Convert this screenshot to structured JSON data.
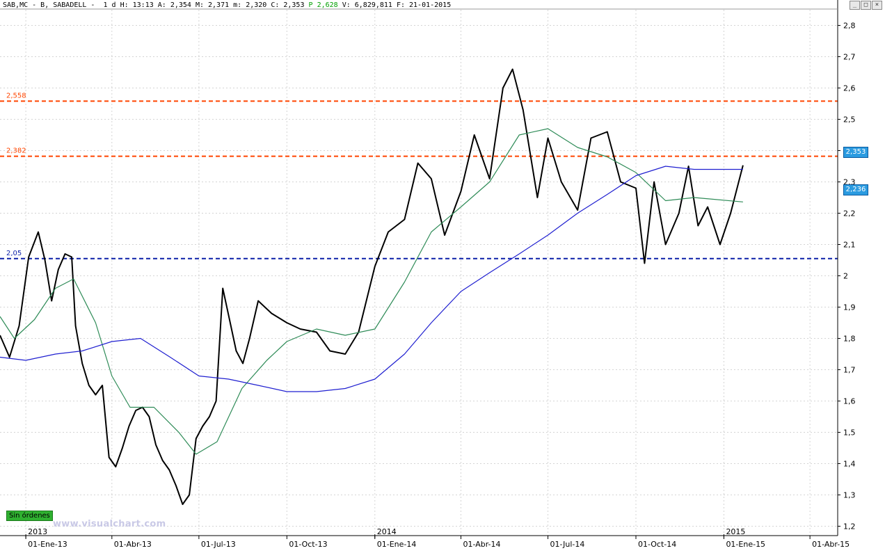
{
  "header": {
    "text": "SAB,MC - B, SABADELL -  1 d H: 13:13 A: 2,354 M: 2,371 m: 2,320 C: 2,353 ",
    "p_label": "P",
    "p_value": "2,628",
    "tail": " V: 6,829,811 F: 21-01-2015"
  },
  "window_buttons": [
    "_",
    "□",
    "×"
  ],
  "status_label": "Sin órdenes",
  "watermark": "www.visualchart.com",
  "price_badges": {
    "last": "2,353",
    "ma": "2,236"
  },
  "colors": {
    "candles": "#000000",
    "ma_short": "#2e8b57",
    "ma_long": "#1f1fd0",
    "resistance": "#ff4500",
    "support": "#0a1fa8",
    "badge": "#2b9be0",
    "grid": "#d4d4d4"
  },
  "chart_data": {
    "type": "line",
    "title": "SAB,MC - B, SABADELL",
    "x_axis": {
      "tick_labels": [
        "01-Ene-13",
        "01-Abr-13",
        "01-Jul-13",
        "01-Oct-13",
        "01-Ene-14",
        "01-Abr-14",
        "01-Jul-14",
        "01-Oct-14",
        "01-Ene-15",
        "01-Abr-15"
      ],
      "year_labels": [
        "2013",
        "2014",
        "2015"
      ],
      "range": [
        "2012-12-05",
        "2015-04-30"
      ]
    },
    "y_axis": {
      "tick_labels": [
        "1,2",
        "1,3",
        "1,4",
        "1,5",
        "1,6",
        "1,7",
        "1,8",
        "1,9",
        "2",
        "2,1",
        "2,2",
        "2,3",
        "2,4",
        "2,5",
        "2,6",
        "2,7",
        "2,8"
      ],
      "range": [
        1.17,
        2.85
      ],
      "grid": true
    },
    "horizontal_lines": [
      {
        "label": "2,558",
        "value": 2.558,
        "color": "#ff4500"
      },
      {
        "label": "2,382",
        "value": 2.382,
        "color": "#ff4500"
      },
      {
        "label": "2,05",
        "value": 2.055,
        "color": "#0a1fa8"
      }
    ],
    "series": [
      {
        "kind": "price",
        "color": "#000000",
        "points": [
          [
            "2012-12-05",
            1.81
          ],
          [
            "2012-12-15",
            1.74
          ],
          [
            "2012-12-25",
            1.84
          ],
          [
            "2013-01-04",
            2.06
          ],
          [
            "2013-01-14",
            2.14
          ],
          [
            "2013-01-21",
            2.05
          ],
          [
            "2013-01-28",
            1.92
          ],
          [
            "2013-02-04",
            2.02
          ],
          [
            "2013-02-11",
            2.07
          ],
          [
            "2013-02-18",
            2.06
          ],
          [
            "2013-02-22",
            1.84
          ],
          [
            "2013-03-01",
            1.72
          ],
          [
            "2013-03-08",
            1.65
          ],
          [
            "2013-03-15",
            1.62
          ],
          [
            "2013-03-22",
            1.65
          ],
          [
            "2013-03-29",
            1.42
          ],
          [
            "2013-04-05",
            1.39
          ],
          [
            "2013-04-12",
            1.45
          ],
          [
            "2013-04-19",
            1.52
          ],
          [
            "2013-04-26",
            1.57
          ],
          [
            "2013-05-03",
            1.58
          ],
          [
            "2013-05-10",
            1.55
          ],
          [
            "2013-05-17",
            1.46
          ],
          [
            "2013-05-24",
            1.41
          ],
          [
            "2013-05-31",
            1.38
          ],
          [
            "2013-06-07",
            1.33
          ],
          [
            "2013-06-14",
            1.27
          ],
          [
            "2013-06-21",
            1.3
          ],
          [
            "2013-06-28",
            1.48
          ],
          [
            "2013-07-05",
            1.52
          ],
          [
            "2013-07-12",
            1.55
          ],
          [
            "2013-07-19",
            1.6
          ],
          [
            "2013-07-26",
            1.96
          ],
          [
            "2013-08-02",
            1.86
          ],
          [
            "2013-08-09",
            1.76
          ],
          [
            "2013-08-16",
            1.72
          ],
          [
            "2013-08-23",
            1.8
          ],
          [
            "2013-09-01",
            1.92
          ],
          [
            "2013-09-15",
            1.88
          ],
          [
            "2013-10-01",
            1.85
          ],
          [
            "2013-10-15",
            1.83
          ],
          [
            "2013-11-01",
            1.82
          ],
          [
            "2013-11-15",
            1.76
          ],
          [
            "2013-12-01",
            1.75
          ],
          [
            "2013-12-15",
            1.82
          ],
          [
            "2014-01-01",
            2.03
          ],
          [
            "2014-01-15",
            2.14
          ],
          [
            "2014-02-01",
            2.18
          ],
          [
            "2014-02-15",
            2.36
          ],
          [
            "2014-03-01",
            2.31
          ],
          [
            "2014-03-15",
            2.13
          ],
          [
            "2014-04-01",
            2.27
          ],
          [
            "2014-04-15",
            2.45
          ],
          [
            "2014-05-01",
            2.31
          ],
          [
            "2014-05-15",
            2.6
          ],
          [
            "2014-05-25",
            2.66
          ],
          [
            "2014-06-05",
            2.53
          ],
          [
            "2014-06-20",
            2.25
          ],
          [
            "2014-07-01",
            2.44
          ],
          [
            "2014-07-15",
            2.3
          ],
          [
            "2014-08-01",
            2.21
          ],
          [
            "2014-08-15",
            2.44
          ],
          [
            "2014-09-01",
            2.46
          ],
          [
            "2014-09-15",
            2.3
          ],
          [
            "2014-10-01",
            2.28
          ],
          [
            "2014-10-10",
            2.04
          ],
          [
            "2014-10-20",
            2.3
          ],
          [
            "2014-11-01",
            2.1
          ],
          [
            "2014-11-15",
            2.2
          ],
          [
            "2014-11-25",
            2.35
          ],
          [
            "2014-12-05",
            2.16
          ],
          [
            "2014-12-15",
            2.22
          ],
          [
            "2014-12-28",
            2.1
          ],
          [
            "2015-01-08",
            2.2
          ],
          [
            "2015-01-21",
            2.353
          ]
        ]
      },
      {
        "kind": "moving_average",
        "color": "#2e8b57",
        "points": [
          [
            "2012-12-05",
            1.87
          ],
          [
            "2012-12-20",
            1.8
          ],
          [
            "2013-01-10",
            1.86
          ],
          [
            "2013-02-01",
            1.96
          ],
          [
            "2013-02-20",
            1.99
          ],
          [
            "2013-03-15",
            1.85
          ],
          [
            "2013-04-01",
            1.68
          ],
          [
            "2013-04-20",
            1.58
          ],
          [
            "2013-05-15",
            1.58
          ],
          [
            "2013-06-10",
            1.5
          ],
          [
            "2013-06-28",
            1.43
          ],
          [
            "2013-07-20",
            1.47
          ],
          [
            "2013-08-15",
            1.64
          ],
          [
            "2013-09-10",
            1.73
          ],
          [
            "2013-10-01",
            1.79
          ],
          [
            "2013-11-01",
            1.83
          ],
          [
            "2013-12-01",
            1.81
          ],
          [
            "2014-01-01",
            1.83
          ],
          [
            "2014-02-01",
            1.98
          ],
          [
            "2014-03-01",
            2.14
          ],
          [
            "2014-04-01",
            2.22
          ],
          [
            "2014-05-01",
            2.3
          ],
          [
            "2014-06-01",
            2.45
          ],
          [
            "2014-07-01",
            2.47
          ],
          [
            "2014-08-01",
            2.41
          ],
          [
            "2014-09-01",
            2.38
          ],
          [
            "2014-10-01",
            2.33
          ],
          [
            "2014-11-01",
            2.24
          ],
          [
            "2014-12-01",
            2.25
          ],
          [
            "2015-01-21",
            2.236
          ]
        ]
      },
      {
        "kind": "moving_average",
        "color": "#1f1fd0",
        "points": [
          [
            "2012-12-05",
            1.74
          ],
          [
            "2013-01-01",
            1.73
          ],
          [
            "2013-02-01",
            1.75
          ],
          [
            "2013-03-01",
            1.76
          ],
          [
            "2013-04-01",
            1.79
          ],
          [
            "2013-05-01",
            1.8
          ],
          [
            "2013-06-01",
            1.74
          ],
          [
            "2013-07-01",
            1.68
          ],
          [
            "2013-08-01",
            1.67
          ],
          [
            "2013-09-01",
            1.65
          ],
          [
            "2013-10-01",
            1.63
          ],
          [
            "2013-11-01",
            1.63
          ],
          [
            "2013-12-01",
            1.64
          ],
          [
            "2014-01-01",
            1.67
          ],
          [
            "2014-02-01",
            1.75
          ],
          [
            "2014-03-01",
            1.85
          ],
          [
            "2014-04-01",
            1.95
          ],
          [
            "2014-05-01",
            2.01
          ],
          [
            "2014-06-01",
            2.07
          ],
          [
            "2014-07-01",
            2.13
          ],
          [
            "2014-08-01",
            2.2
          ],
          [
            "2014-09-01",
            2.26
          ],
          [
            "2014-10-01",
            2.32
          ],
          [
            "2014-11-01",
            2.35
          ],
          [
            "2014-12-01",
            2.34
          ],
          [
            "2015-01-21",
            2.34
          ]
        ]
      }
    ]
  }
}
